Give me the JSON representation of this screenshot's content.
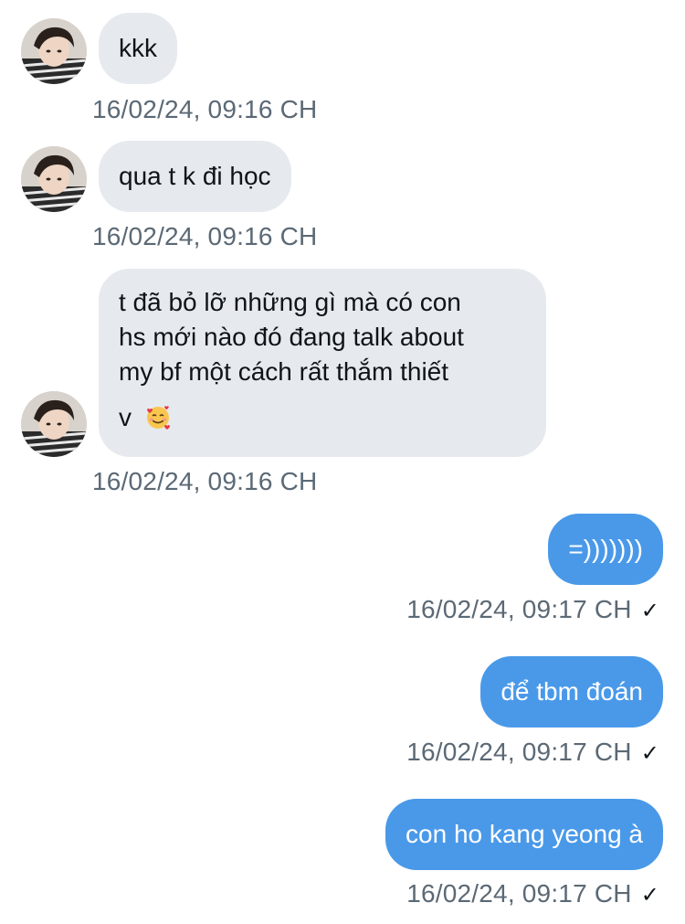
{
  "messages": [
    {
      "direction": "in",
      "text": "kkk",
      "timestamp": "16/02/24, 09:16 CH"
    },
    {
      "direction": "in",
      "text": "qua t k đi học",
      "timestamp": "16/02/24, 09:16 CH"
    },
    {
      "direction": "in",
      "lines": [
        "t đã bỏ lỡ những gì mà có con",
        "hs mới nào đó đang talk about",
        "my bf một cách rất thắm thiết",
        "v"
      ],
      "emoji": "smiling-face-with-hearts",
      "timestamp": "16/02/24, 09:16 CH"
    },
    {
      "direction": "out",
      "text": "=)))))))",
      "timestamp": "16/02/24, 09:17 CH",
      "status": "✓"
    },
    {
      "direction": "out",
      "text": "để tbm đoán",
      "timestamp": "16/02/24, 09:17 CH",
      "status": "✓"
    },
    {
      "direction": "out",
      "text": "con ho kang yeong à",
      "timestamp": "16/02/24, 09:17 CH",
      "status": "✓"
    }
  ],
  "colors": {
    "incoming_bubble": "#e6eaee",
    "outgoing_bubble": "#4a99e9",
    "timestamp_text": "#5b6975"
  }
}
